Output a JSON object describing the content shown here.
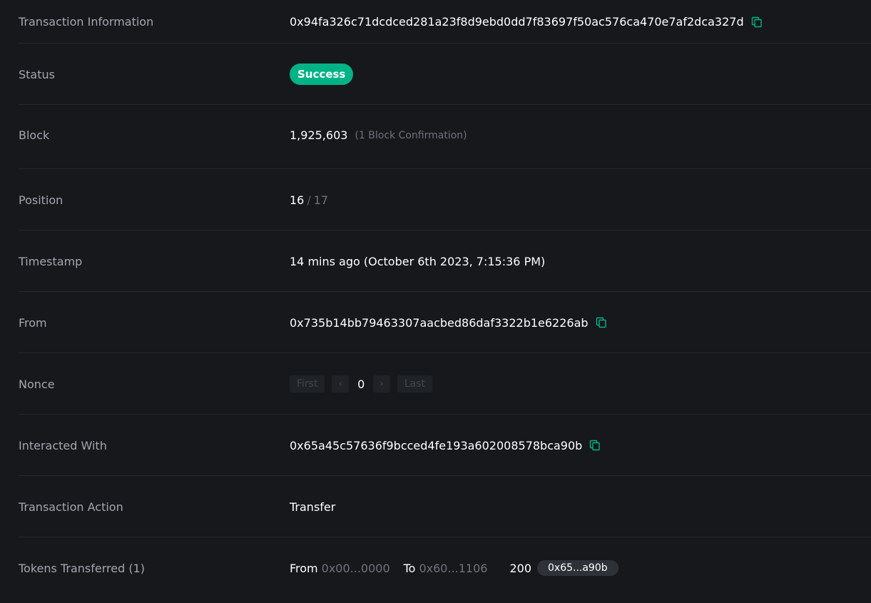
{
  "rows": {
    "transaction_information": {
      "label": "Transaction Information",
      "value": "0x94fa326c71dcdced281a23f8d9ebd0dd7f83697f50ac576ca470e7af2dca327d"
    },
    "status": {
      "label": "Status",
      "badge": "Success"
    },
    "block": {
      "label": "Block",
      "number": "1,925,603",
      "confirmations": "(1 Block Confirmation)"
    },
    "position": {
      "label": "Position",
      "index": "16",
      "separator": "/",
      "total": "17"
    },
    "timestamp": {
      "label": "Timestamp",
      "value": "14 mins ago (October 6th 2023, 7:15:36 PM)"
    },
    "from": {
      "label": "From",
      "value": "0x735b14bb79463307aacbed86daf3322b1e6226ab"
    },
    "nonce": {
      "label": "Nonce",
      "first": "First",
      "prev": "‹",
      "value": "0",
      "next": "›",
      "last": "Last"
    },
    "interacted_with": {
      "label": "Interacted With",
      "value": "0x65a45c57636f9bcced4fe193a602008578bca90b"
    },
    "transaction_action": {
      "label": "Transaction Action",
      "value": "Transfer"
    },
    "tokens_transferred": {
      "label": "Tokens Transferred (1)",
      "from_label": "From",
      "from_addr": "0x00...0000",
      "to_label": "To",
      "to_addr": "0x60...1106",
      "amount": "200",
      "token": "0x65...a90b"
    }
  },
  "colors": {
    "background": "#16181c",
    "accent": "#00b386",
    "label": "#a3a7ad",
    "muted": "#70747b"
  },
  "icons": {
    "copy": "copy-icon"
  }
}
